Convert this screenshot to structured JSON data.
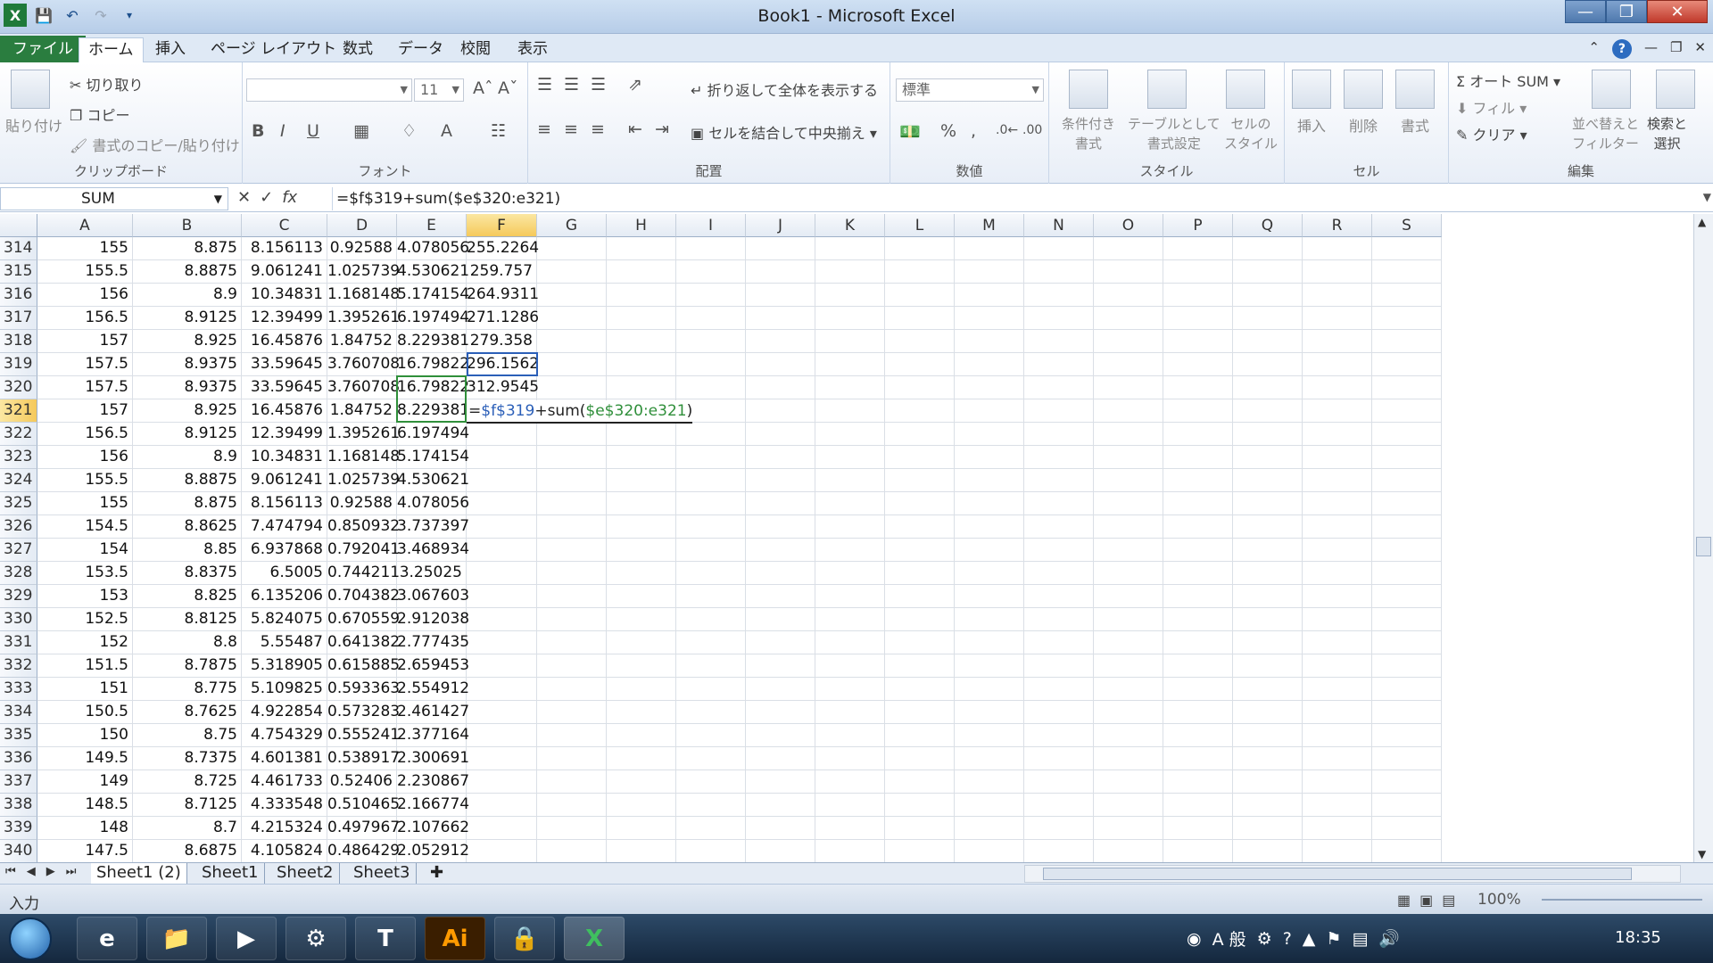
{
  "window": {
    "title": "Book1 - Microsoft Excel"
  },
  "tabs": [
    "ファイル",
    "ホーム",
    "挿入",
    "ページ レイアウト",
    "数式",
    "データ",
    "校閲",
    "表示"
  ],
  "ribbon": {
    "clipboard": {
      "paste": "貼り付け",
      "cut": "切り取り",
      "copy": "コピー",
      "format_painter": "書式のコピー/貼り付け",
      "label": "クリップボード"
    },
    "font": {
      "size": "11",
      "label": "フォント",
      "bold": "B",
      "italic": "I",
      "underline": "U"
    },
    "alignment": {
      "wrap": "折り返して全体を表示する",
      "merge": "セルを結合して中央揃え",
      "label": "配置"
    },
    "number": {
      "format": "標準",
      "percent": "%",
      "comma": ",",
      "label": "数値"
    },
    "styles": {
      "conditional": "条件付き\n書式",
      "table": "テーブルとして\n書式設定",
      "cell_styles": "セルの\nスタイル",
      "label": "スタイル"
    },
    "cells": {
      "insert": "挿入",
      "delete": "削除",
      "format": "書式",
      "label": "セル"
    },
    "editing": {
      "autosum": "Σ オート SUM",
      "fill": "フィル",
      "clear": "クリア",
      "sort": "並べ替えと\nフィルター",
      "find": "検索と\n選択",
      "label": "編集"
    }
  },
  "formula_bar": {
    "name_box": "SUM",
    "formula": "=$f$319+sum($e$320:e321)"
  },
  "columns": [
    "A",
    "B",
    "C",
    "D",
    "E",
    "F",
    "G",
    "H",
    "I",
    "J",
    "K",
    "L",
    "M",
    "N",
    "O",
    "P",
    "Q",
    "R",
    "S"
  ],
  "rows": [
    {
      "n": "314",
      "a": "155",
      "b": "8.875",
      "c": "8.156113",
      "d": "0.92588",
      "e": "4.078056",
      "f": "255.2264"
    },
    {
      "n": "315",
      "a": "155.5",
      "b": "8.8875",
      "c": "9.061241",
      "d": "1.025739",
      "e": "4.530621",
      "f": "259.757"
    },
    {
      "n": "316",
      "a": "156",
      "b": "8.9",
      "c": "10.34831",
      "d": "1.168148",
      "e": "5.174154",
      "f": "264.9311"
    },
    {
      "n": "317",
      "a": "156.5",
      "b": "8.9125",
      "c": "12.39499",
      "d": "1.395261",
      "e": "6.197494",
      "f": "271.1286"
    },
    {
      "n": "318",
      "a": "157",
      "b": "8.925",
      "c": "16.45876",
      "d": "1.84752",
      "e": "8.229381",
      "f": "279.358"
    },
    {
      "n": "319",
      "a": "157.5",
      "b": "8.9375",
      "c": "33.59645",
      "d": "3.760708",
      "e": "16.79822",
      "f": "296.1562"
    },
    {
      "n": "320",
      "a": "157.5",
      "b": "8.9375",
      "c": "33.59645",
      "d": "3.760708",
      "e": "16.79822",
      "f": "312.9545"
    },
    {
      "n": "321",
      "a": "157",
      "b": "8.925",
      "c": "16.45876",
      "d": "1.84752",
      "e": "8.229381",
      "f": ""
    },
    {
      "n": "322",
      "a": "156.5",
      "b": "8.9125",
      "c": "12.39499",
      "d": "1.395261",
      "e": "6.197494",
      "f": ""
    },
    {
      "n": "323",
      "a": "156",
      "b": "8.9",
      "c": "10.34831",
      "d": "1.168148",
      "e": "5.174154",
      "f": ""
    },
    {
      "n": "324",
      "a": "155.5",
      "b": "8.8875",
      "c": "9.061241",
      "d": "1.025739",
      "e": "4.530621",
      "f": ""
    },
    {
      "n": "325",
      "a": "155",
      "b": "8.875",
      "c": "8.156113",
      "d": "0.92588",
      "e": "4.078056",
      "f": ""
    },
    {
      "n": "326",
      "a": "154.5",
      "b": "8.8625",
      "c": "7.474794",
      "d": "0.850932",
      "e": "3.737397",
      "f": ""
    },
    {
      "n": "327",
      "a": "154",
      "b": "8.85",
      "c": "6.937868",
      "d": "0.792041",
      "e": "3.468934",
      "f": ""
    },
    {
      "n": "328",
      "a": "153.5",
      "b": "8.8375",
      "c": "6.5005",
      "d": "0.744211",
      "e": "3.25025",
      "f": ""
    },
    {
      "n": "329",
      "a": "153",
      "b": "8.825",
      "c": "6.135206",
      "d": "0.704382",
      "e": "3.067603",
      "f": ""
    },
    {
      "n": "330",
      "a": "152.5",
      "b": "8.8125",
      "c": "5.824075",
      "d": "0.670559",
      "e": "2.912038",
      "f": ""
    },
    {
      "n": "331",
      "a": "152",
      "b": "8.8",
      "c": "5.55487",
      "d": "0.641382",
      "e": "2.777435",
      "f": ""
    },
    {
      "n": "332",
      "a": "151.5",
      "b": "8.7875",
      "c": "5.318905",
      "d": "0.615885",
      "e": "2.659453",
      "f": ""
    },
    {
      "n": "333",
      "a": "151",
      "b": "8.775",
      "c": "5.109825",
      "d": "0.593363",
      "e": "2.554912",
      "f": ""
    },
    {
      "n": "334",
      "a": "150.5",
      "b": "8.7625",
      "c": "4.922854",
      "d": "0.573283",
      "e": "2.461427",
      "f": ""
    },
    {
      "n": "335",
      "a": "150",
      "b": "8.75",
      "c": "4.754329",
      "d": "0.555241",
      "e": "2.377164",
      "f": ""
    },
    {
      "n": "336",
      "a": "149.5",
      "b": "8.7375",
      "c": "4.601381",
      "d": "0.538917",
      "e": "2.300691",
      "f": ""
    },
    {
      "n": "337",
      "a": "149",
      "b": "8.725",
      "c": "4.461733",
      "d": "0.52406",
      "e": "2.230867",
      "f": ""
    },
    {
      "n": "338",
      "a": "148.5",
      "b": "8.7125",
      "c": "4.333548",
      "d": "0.510465",
      "e": "2.166774",
      "f": ""
    },
    {
      "n": "339",
      "a": "148",
      "b": "8.7",
      "c": "4.215324",
      "d": "0.497967",
      "e": "2.107662",
      "f": ""
    },
    {
      "n": "340",
      "a": "147.5",
      "b": "8.6875",
      "c": "4.105824",
      "d": "0.486429",
      "e": "2.052912",
      "f": ""
    }
  ],
  "active_cell": {
    "row": "321",
    "col": "F",
    "edit_parts": [
      "=",
      "$f$319",
      "+sum(",
      "$e$320:e321",
      ")"
    ]
  },
  "sheets": [
    "Sheet1 (2)",
    "Sheet1",
    "Sheet2",
    "Sheet3"
  ],
  "status": {
    "mode": "入力",
    "zoom": "100%"
  },
  "taskbar": {
    "clock": "18:35",
    "ime": "A 般"
  },
  "colors": {
    "file_tab": "#2a7d3f",
    "ref_blue": "#2b5fb8",
    "ref_green": "#2f8f3a",
    "active_header": "#f5c95b"
  }
}
